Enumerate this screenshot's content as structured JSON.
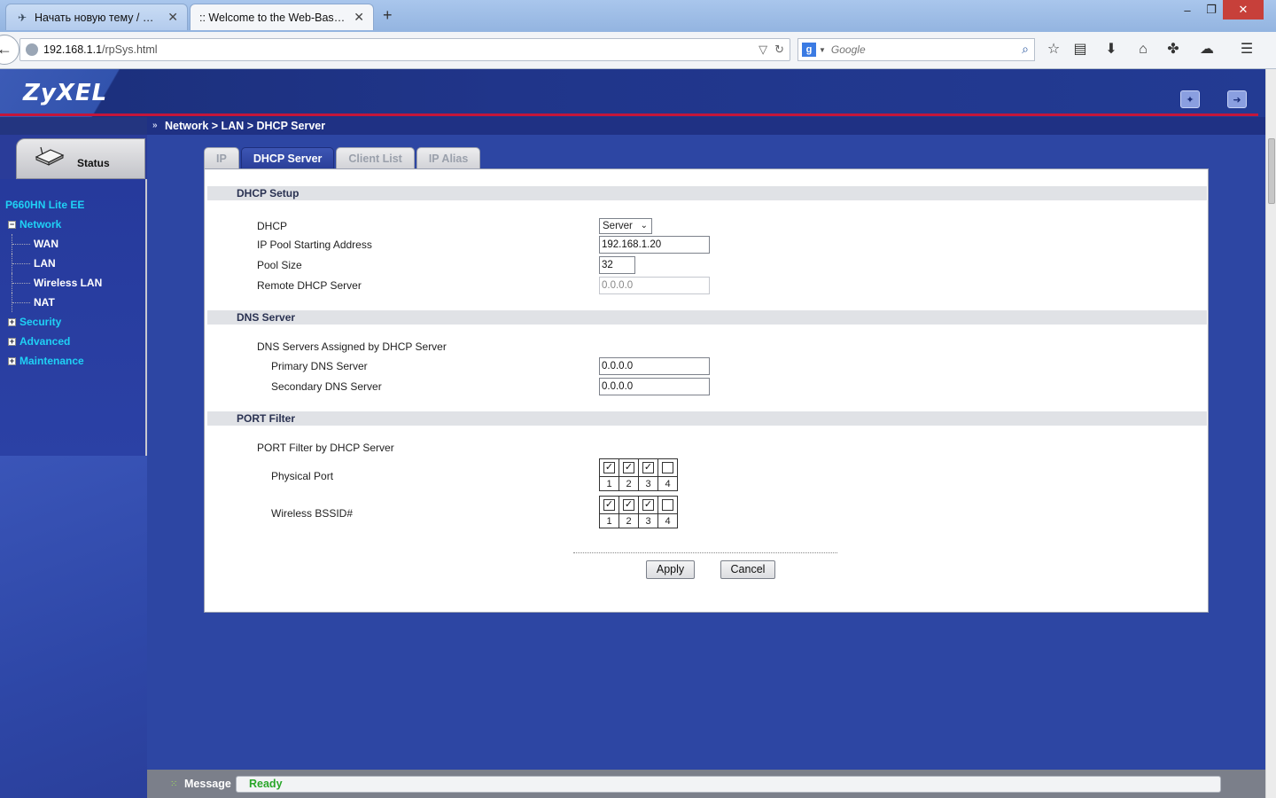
{
  "browser": {
    "tabs": [
      {
        "title": "Начать новую тему / Фор...",
        "active": false
      },
      {
        "title": ":: Welcome to the Web-Based ...",
        "active": true
      }
    ],
    "url_host": "192.168.1.1",
    "url_path": "/rpSys.html",
    "search_placeholder": "Google"
  },
  "router": {
    "logo": "ZyXEL",
    "breadcrumb": "Network > LAN > DHCP Server",
    "status_label": "Status",
    "model": "P660HN Lite EE",
    "menu": [
      {
        "label": "Network",
        "expanded": true,
        "children": [
          "WAN",
          "LAN",
          "Wireless LAN",
          "NAT"
        ]
      },
      {
        "label": "Security",
        "expanded": false
      },
      {
        "label": "Advanced",
        "expanded": false
      },
      {
        "label": "Maintenance",
        "expanded": false
      }
    ],
    "tabs": [
      "IP",
      "DHCP Server",
      "Client List",
      "IP Alias"
    ],
    "active_tab": "DHCP Server",
    "dhcp_setup": {
      "title": "DHCP Setup",
      "dhcp_label": "DHCP",
      "dhcp_value": "Server",
      "pool_start_label": "IP Pool Starting Address",
      "pool_start_value": "192.168.1.20",
      "pool_size_label": "Pool Size",
      "pool_size_value": "32",
      "remote_label": "Remote DHCP Server",
      "remote_value": "0.0.0.0"
    },
    "dns": {
      "title": "DNS Server",
      "assigned_label": "DNS Servers Assigned by DHCP Server",
      "primary_label": "Primary DNS Server",
      "primary_value": "0.0.0.0",
      "secondary_label": "Secondary DNS Server",
      "secondary_value": "0.0.0.0"
    },
    "port_filter": {
      "title": "PORT Filter",
      "by_label": "PORT Filter by DHCP Server",
      "physical_label": "Physical Port",
      "physical_checked": [
        true,
        true,
        true,
        false
      ],
      "wireless_label": "Wireless BSSID#",
      "wireless_checked": [
        true,
        true,
        true,
        false
      ],
      "numbers": [
        "1",
        "2",
        "3",
        "4"
      ]
    },
    "apply_label": "Apply",
    "cancel_label": "Cancel",
    "message_label": "Message",
    "message_value": "Ready"
  },
  "colors": {
    "header_blue": "#1b2f7a",
    "accent_cyan": "#1fd1f5",
    "red_line": "#c4163a",
    "ready_green": "#28a628"
  }
}
